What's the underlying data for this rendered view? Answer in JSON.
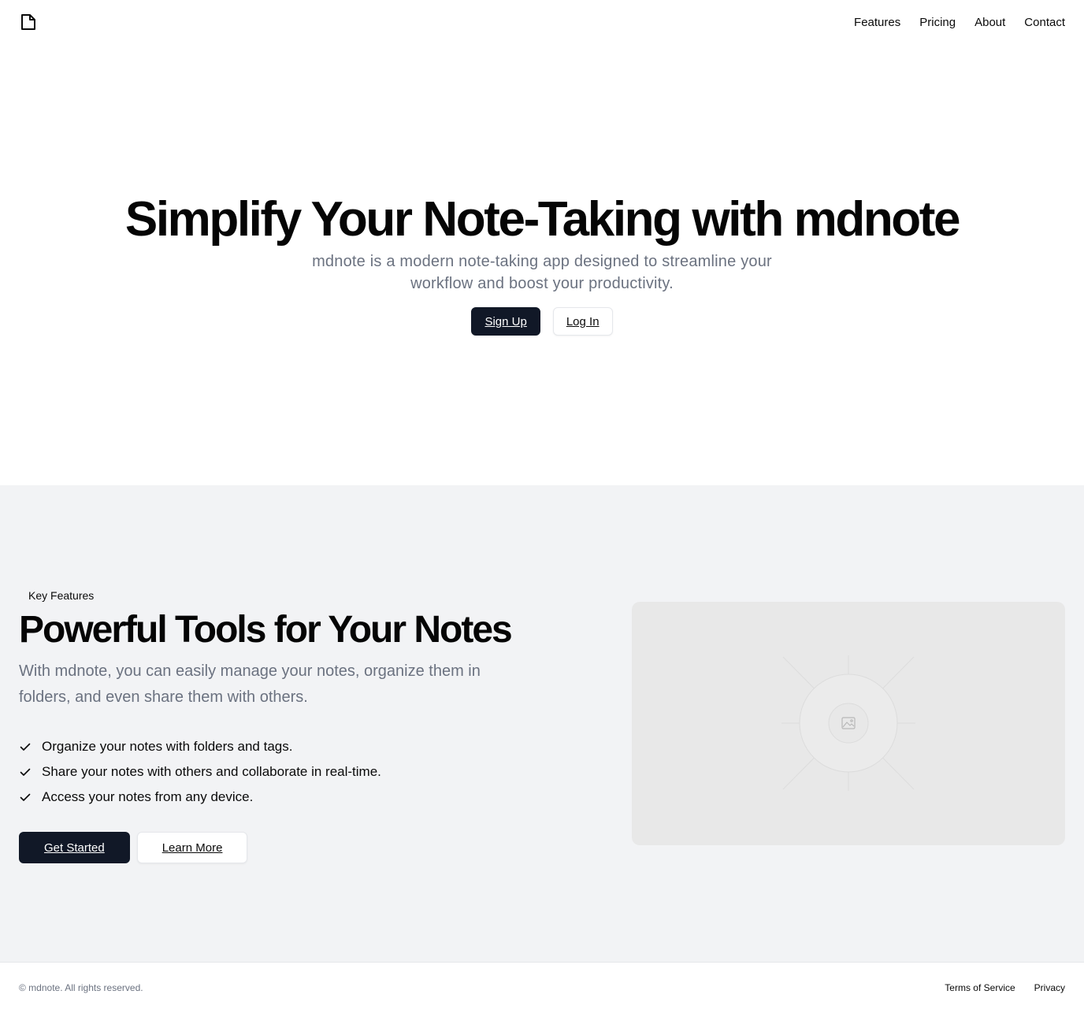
{
  "header": {
    "logo_icon": "file-icon",
    "nav": [
      {
        "label": "Features"
      },
      {
        "label": "Pricing"
      },
      {
        "label": "About"
      },
      {
        "label": "Contact"
      }
    ]
  },
  "hero": {
    "title": "Simplify Your Note-Taking with mdnote",
    "subtitle": "mdnote is a modern note-taking app designed to streamline your workflow and boost your productivity.",
    "primary_button": "Sign Up",
    "secondary_button": "Log In"
  },
  "features": {
    "badge": "Key Features",
    "title": "Powerful Tools for Your Notes",
    "description": "With mdnote, you can easily manage your notes, organize them in folders, and even share them with others.",
    "items": [
      {
        "text": "Organize your notes with folders and tags.",
        "icon": "check-icon"
      },
      {
        "text": "Share your notes with others and collaborate in real-time.",
        "icon": "check-icon"
      },
      {
        "text": "Access your notes from any device.",
        "icon": "check-icon"
      }
    ],
    "primary_button": "Get Started",
    "secondary_button": "Learn More",
    "image_icon": "image-placeholder-icon"
  },
  "footer": {
    "copyright": "© mdnote. All rights reserved.",
    "links": [
      {
        "label": "Terms of Service"
      },
      {
        "label": "Privacy"
      }
    ]
  },
  "colors": {
    "primary": "#111827",
    "muted_text": "#6b7280",
    "section_bg": "#f2f3f5",
    "placeholder_bg": "#e8e8e8"
  }
}
